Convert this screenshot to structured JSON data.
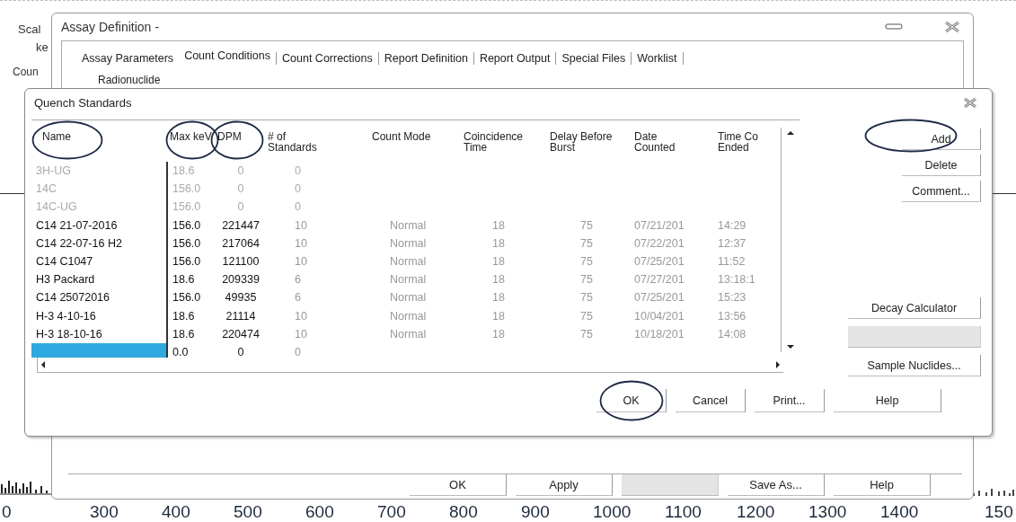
{
  "background_app": {
    "labels": [
      "Scal",
      "ke",
      "Coun"
    ],
    "axis_labels": [
      "0",
      "300",
      "400",
      "500",
      "600",
      "700",
      "800",
      "900",
      "1000",
      "1100",
      "1200",
      "1300",
      "1400",
      "150"
    ]
  },
  "assay_window": {
    "title": "Assay Definition -",
    "tabs": [
      {
        "label": "Assay Parameters",
        "selected": false
      },
      {
        "label": "Count Conditions",
        "selected": true
      },
      {
        "label": "Count Corrections",
        "selected": false
      },
      {
        "label": "Report Definition",
        "selected": false
      },
      {
        "label": "Report Output",
        "selected": false
      },
      {
        "label": "Special Files",
        "selected": false
      },
      {
        "label": "Worklist",
        "selected": false
      }
    ],
    "group_label": "Radionuclide",
    "buttons": [
      {
        "label": "OK",
        "disabled": false
      },
      {
        "label": "Apply",
        "disabled": false
      },
      {
        "disabled": true
      },
      {
        "label": "Save As...",
        "disabled": false
      },
      {
        "label": "Help",
        "disabled": false
      }
    ]
  },
  "quench_dialog": {
    "title": "Quench Standards",
    "table": {
      "columns": [
        {
          "label": "Name",
          "circled": true
        },
        {
          "label": "Max keV",
          "circled": true
        },
        {
          "label": "DPM",
          "circled": true
        },
        {
          "label": "# of\nStandards",
          "circled": false
        },
        {
          "label": "Count Mode",
          "circled": false
        },
        {
          "label": "Coincidence\nTime",
          "circled": false
        },
        {
          "label": "Delay Before\nBurst",
          "circled": false
        },
        {
          "label": "Date\nCounted",
          "circled": false
        },
        {
          "label": "Time Co\nEnded",
          "circled": false
        }
      ],
      "rows": [
        {
          "dimmed": true,
          "selected": false,
          "cells": [
            "3H-UG",
            "18.6",
            "0",
            "0"
          ]
        },
        {
          "dimmed": true,
          "selected": false,
          "cells": [
            "14C",
            "156.0",
            "0",
            "0"
          ]
        },
        {
          "dimmed": true,
          "selected": false,
          "cells": [
            "14C-UG",
            "156.0",
            "0",
            "0"
          ]
        },
        {
          "dimmed": false,
          "selected": false,
          "cells": [
            "C14 21-07-2016",
            "156.0",
            "221447",
            "10",
            "Normal",
            "18",
            "75",
            "07/21/201",
            "14:29"
          ]
        },
        {
          "dimmed": false,
          "selected": false,
          "cells": [
            "C14 22-07-16 H2",
            "156.0",
            "217064",
            "10",
            "Normal",
            "18",
            "75",
            "07/22/201",
            "12:37"
          ]
        },
        {
          "dimmed": false,
          "selected": false,
          "cells": [
            "C14 C1047",
            "156.0",
            "121100",
            "10",
            "Normal",
            "18",
            "75",
            "07/25/201",
            "11:52"
          ]
        },
        {
          "dimmed": false,
          "selected": false,
          "cells": [
            "H3 Packard",
            "18.6",
            "209339",
            "6",
            "Normal",
            "18",
            "75",
            "07/27/201",
            "13:18:1"
          ]
        },
        {
          "dimmed": false,
          "selected": false,
          "cells": [
            "C14 25072016",
            "156.0",
            "49935",
            "6",
            "Normal",
            "18",
            "75",
            "07/25/201",
            "15:23"
          ]
        },
        {
          "dimmed": false,
          "selected": false,
          "cells": [
            "H-3 4-10-16",
            "18.6",
            "21114",
            "10",
            "Normal",
            "18",
            "75",
            "10/04/201",
            "13:56"
          ]
        },
        {
          "dimmed": false,
          "selected": false,
          "cells": [
            "H-3 18-10-16",
            "18.6",
            "220474",
            "10",
            "Normal",
            "18",
            "75",
            "10/18/201",
            "14:08"
          ]
        },
        {
          "dimmed": false,
          "selected": true,
          "cells": [
            null,
            "0.0",
            "0",
            "0"
          ]
        }
      ]
    },
    "side_buttons": [
      {
        "label": "Add",
        "disabled": false,
        "circled": true
      },
      {
        "label": "Delete",
        "disabled": false,
        "circled": false
      },
      {
        "label": "Comment...",
        "disabled": false,
        "circled": false
      },
      {
        "label": "Decay Calculator",
        "disabled": false,
        "circled": false
      },
      {
        "disabled": true,
        "circled": false
      },
      {
        "label": "Sample Nuclides...",
        "disabled": false,
        "circled": false
      }
    ],
    "buttons": [
      {
        "label": "OK",
        "circled": true
      },
      {
        "label": "Cancel",
        "circled": false
      },
      {
        "label": "Print...",
        "circled": false
      },
      {
        "label": "Help",
        "circled": false
      }
    ]
  }
}
